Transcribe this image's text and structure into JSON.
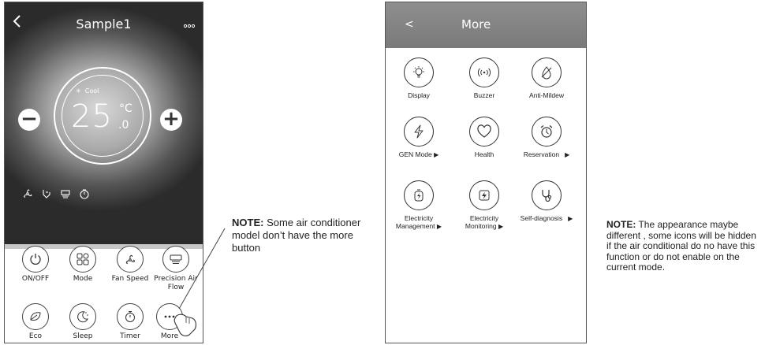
{
  "left_phone": {
    "title": "Sample1",
    "back_icon": "chevron-left-icon",
    "menu_icon": "dots-icon",
    "mode": "Cool",
    "temperature": "25",
    "unit": "°C",
    "decimal": ".0",
    "minus": "−",
    "plus": "+",
    "buttons": [
      {
        "label": "ON/OFF",
        "icon": "power-icon"
      },
      {
        "label": "Mode",
        "icon": "mode-icon"
      },
      {
        "label": "Fan Speed",
        "icon": "fan-icon"
      },
      {
        "label": "Precision Air Flow",
        "icon": "airflow-icon"
      },
      {
        "label": "Eco",
        "icon": "leaf-icon"
      },
      {
        "label": "Sleep",
        "icon": "moon-icon"
      },
      {
        "label": "Timer",
        "icon": "timer-icon"
      },
      {
        "label": "More",
        "icon": "more-icon"
      }
    ]
  },
  "note_left": {
    "bold": "NOTE:",
    "text": " Some air conditioner model don’t have the more button"
  },
  "right_phone": {
    "back": "<",
    "title": "More",
    "tiles": [
      {
        "label": "Display",
        "icon": "bulb-icon",
        "arrow": ""
      },
      {
        "label": "Buzzer",
        "icon": "buzzer-icon",
        "arrow": ""
      },
      {
        "label": "Anti-Mildew",
        "icon": "anti-mildew-icon",
        "arrow": ""
      },
      {
        "label": "GEN Mode",
        "icon": "lightning-icon",
        "arrow": "▶"
      },
      {
        "label": "Health",
        "icon": "heart-icon",
        "arrow": ""
      },
      {
        "label": "Reservation",
        "icon": "alarm-icon",
        "arrow": "▶"
      },
      {
        "label1": "Electricity",
        "label2": "Management",
        "icon": "battery-icon",
        "arrow": "▶"
      },
      {
        "label1": "Electricity",
        "label2": "Monitoring",
        "icon": "monitor-icon",
        "arrow": "▶"
      },
      {
        "label": "Self-diagnosis",
        "icon": "stethoscope-icon",
        "arrow": "▶"
      }
    ]
  },
  "note_right": {
    "bold": "NOTE:",
    "text": " The appearance maybe different , some icons will be hidden if the air conditional do no have this function or do not enable on the current mode."
  }
}
